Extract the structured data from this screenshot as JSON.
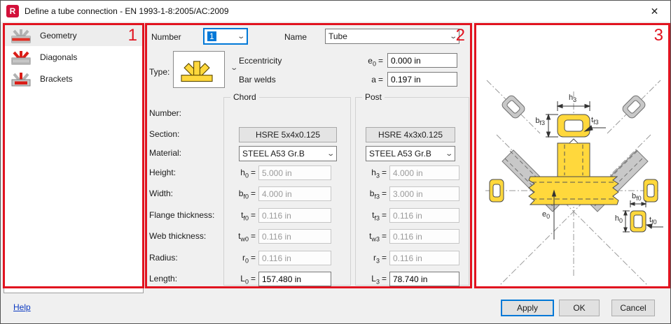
{
  "window": {
    "title": "Define a tube connection - EN 1993-1-8:2005/AC:2009",
    "app_icon_letter": "R",
    "close_glyph": "✕"
  },
  "sidebar": {
    "items": [
      {
        "label": "Geometry"
      },
      {
        "label": "Diagonals"
      },
      {
        "label": "Brackets"
      }
    ]
  },
  "form": {
    "eq": "=",
    "number_label": "Number",
    "number_value": "1",
    "name_label": "Name",
    "name_value": "Tube",
    "type_label": "Type:",
    "eccentricity_label": "Eccentricity",
    "eccentricity": {
      "sym": "e",
      "sub": "0",
      "value": "0.000 in"
    },
    "bar_welds_label": "Bar welds",
    "bar_welds": {
      "sym": "a",
      "sub": "",
      "value": "0.197 in"
    },
    "row_labels": {
      "number": "Number:",
      "section": "Section:",
      "material": "Material:",
      "height": "Height:",
      "width": "Width:",
      "flange": "Flange thickness:",
      "web": "Web thickness:",
      "radius": "Radius:",
      "length": "Length:"
    },
    "chord": {
      "group_label": "Chord",
      "section_button": "HSRE 5x4x0.125",
      "material_value": "STEEL A53 Gr.B",
      "height": {
        "sym": "h",
        "sub": "0",
        "value": "5.000 in"
      },
      "width": {
        "sym": "b",
        "sub": "f0",
        "value": "4.000 in"
      },
      "flange": {
        "sym": "t",
        "sub": "f0",
        "value": "0.116 in"
      },
      "web": {
        "sym": "t",
        "sub": "w0",
        "value": "0.116 in"
      },
      "radius": {
        "sym": "r",
        "sub": "0",
        "value": "0.116 in"
      },
      "length": {
        "sym": "L",
        "sub": "0",
        "value": "157.480 in"
      }
    },
    "post": {
      "group_label": "Post",
      "section_button": "HSRE 4x3x0.125",
      "material_value": "STEEL A53 Gr.B",
      "height": {
        "sym": "h",
        "sub": "3",
        "value": "4.000 in"
      },
      "width": {
        "sym": "b",
        "sub": "f3",
        "value": "3.000 in"
      },
      "flange": {
        "sym": "t",
        "sub": "f3",
        "value": "0.116 in"
      },
      "web": {
        "sym": "t",
        "sub": "w3",
        "value": "0.116 in"
      },
      "radius": {
        "sym": "r",
        "sub": "3",
        "value": "0.116 in"
      },
      "length": {
        "sym": "L",
        "sub": "3",
        "value": "78.740 in"
      }
    }
  },
  "diagram": {
    "labels": {
      "h3": {
        "sym": "h",
        "sub": "3"
      },
      "bf3": {
        "sym": "b",
        "sub": "f3"
      },
      "tf3": {
        "sym": "t",
        "sub": "f3"
      },
      "e0": {
        "sym": "e",
        "sub": "0"
      },
      "bf0": {
        "sym": "b",
        "sub": "f0"
      },
      "h0": {
        "sym": "h",
        "sub": "0"
      },
      "tf0": {
        "sym": "t",
        "sub": "f0"
      }
    },
    "colors": {
      "member_yellow": "#ffd83c",
      "member_gray": "#c8c8c8"
    }
  },
  "annotations": {
    "region1": "1",
    "region2": "2",
    "region3": "3",
    "color": "#e1131f"
  },
  "footer": {
    "help": "Help",
    "apply": "Apply",
    "ok": "OK",
    "cancel": "Cancel"
  }
}
